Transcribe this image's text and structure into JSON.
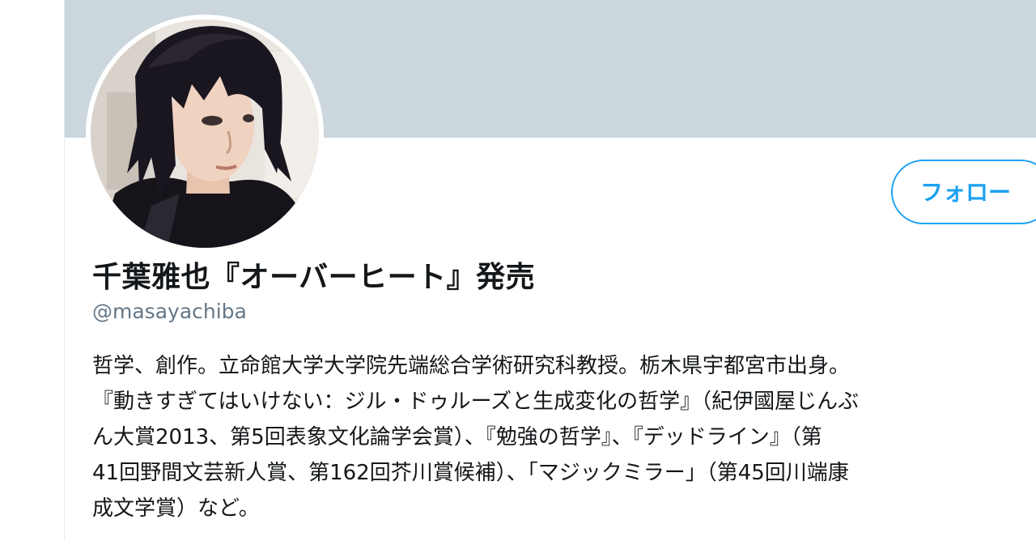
{
  "profile": {
    "display_name": "千葉雅也『オーバーヒート』発売",
    "screen_name": "@masayachiba",
    "follow_label": "フォロー",
    "avatar_alt": "profile-photo",
    "bio_lines": [
      "哲学、創作。立命館大学大学院先端総合学術研究科教授。栃木県宇都宮市出身。",
      "『動きすぎてはいけない：ジル・ドゥルーズと生成変化の哲学』（紀伊國屋じんぶ",
      "ん大賞2013、第5回表象文化論学会賞）、『勉強の哲学』、『デッドライン』（第",
      "41回野間文芸新人賞、第162回芥川賞候補）、「マジックミラー」（第45回川端康",
      "成文学賞）など。"
    ]
  },
  "colors": {
    "banner": "#ccd6dd",
    "accent": "#1da1f2",
    "text_primary": "#14171a",
    "text_secondary": "#657786"
  }
}
